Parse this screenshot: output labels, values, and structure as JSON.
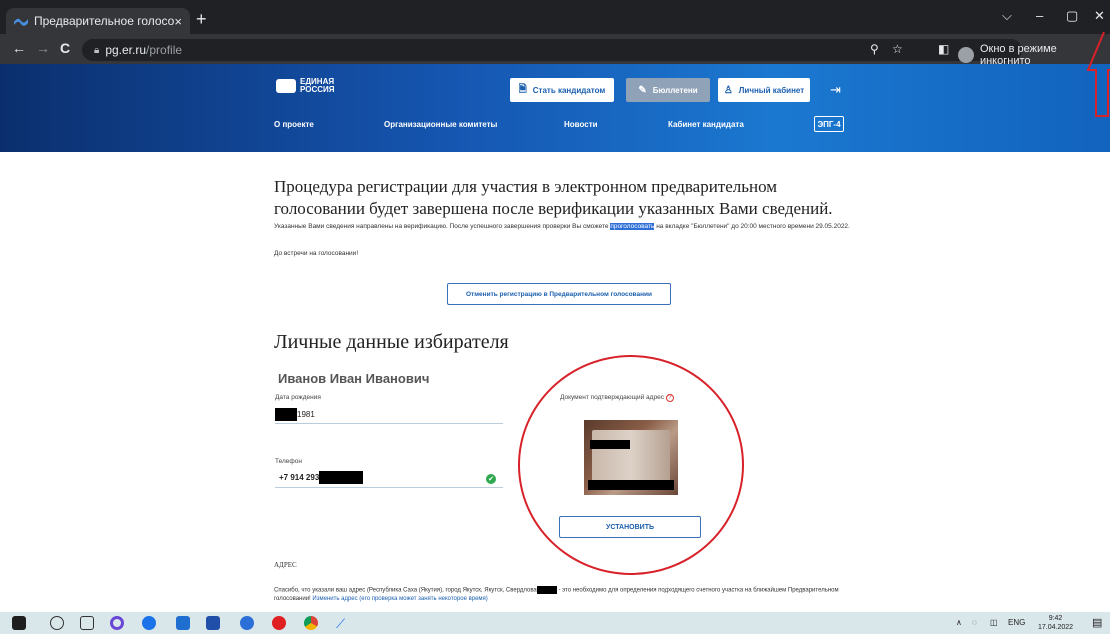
{
  "browser": {
    "tab_title": "Предварительное голосование",
    "tab_close": "×",
    "new_tab": "+",
    "url_domain": "pg.er.ru",
    "url_path": "/profile",
    "incognito_label": "Окно в режиме инкогнито",
    "back": "←",
    "forward": "→",
    "reload": "C",
    "min": "–",
    "max": "▢",
    "close": "✕",
    "dropdown": "⌵"
  },
  "site": {
    "logo_line1": "ЕДИНАЯ",
    "logo_line2": "РОССИЯ",
    "btn_candidate": "Стать кандидатом",
    "btn_ballots": "Бюллетени",
    "btn_cabinet": "Личный кабинет",
    "nav": [
      "О проекте",
      "Организационные комитеты",
      "Новости",
      "Кабинет кандидата"
    ],
    "epg": "ЭПГ-4"
  },
  "content": {
    "heading": "Процедура регистрации для участия в электронном предварительном голосовании будет завершена после верификации указанных Вами сведений.",
    "para_before": "Указанные Вами сведения направлены на верификацию. После успешного завершения проверки Вы сможете ",
    "para_highlight": "проголосовать",
    "para_after": " на вкладке \"Бюллетени\" до 20:00 местного времени 29.05.2022.",
    "para2": "До встречи на голосовании!",
    "cancel_button": "Отменить регистрацию в Предварительном голосовании",
    "section_title": "Личные данные избирателя",
    "voter_name": "Иванов Иван Иванович",
    "dob_label": "Дата рождения",
    "dob_value": "1981",
    "phone_label": "Телефон",
    "phone_value": "+7 914 293",
    "doc_label": "Документ подтверждающий адрес",
    "doc_help": "?",
    "install_button": "УСТАНОВИТЬ",
    "address_title": "АДРЕС",
    "address_text_before": "Спасибо, что указали ваш адрес (Республика Саха (Якутия), город Якутск, Якутск, Свердлова",
    "address_text_after": " - это необходимо для определения подходящего счетного участка на ближайшем Предварительном голосовании! ",
    "address_link": "Изменить адрес (его проверка может занять некоторое время)"
  },
  "taskbar": {
    "lang": "ENG",
    "time": "9:42",
    "date": "17.04.2022"
  }
}
